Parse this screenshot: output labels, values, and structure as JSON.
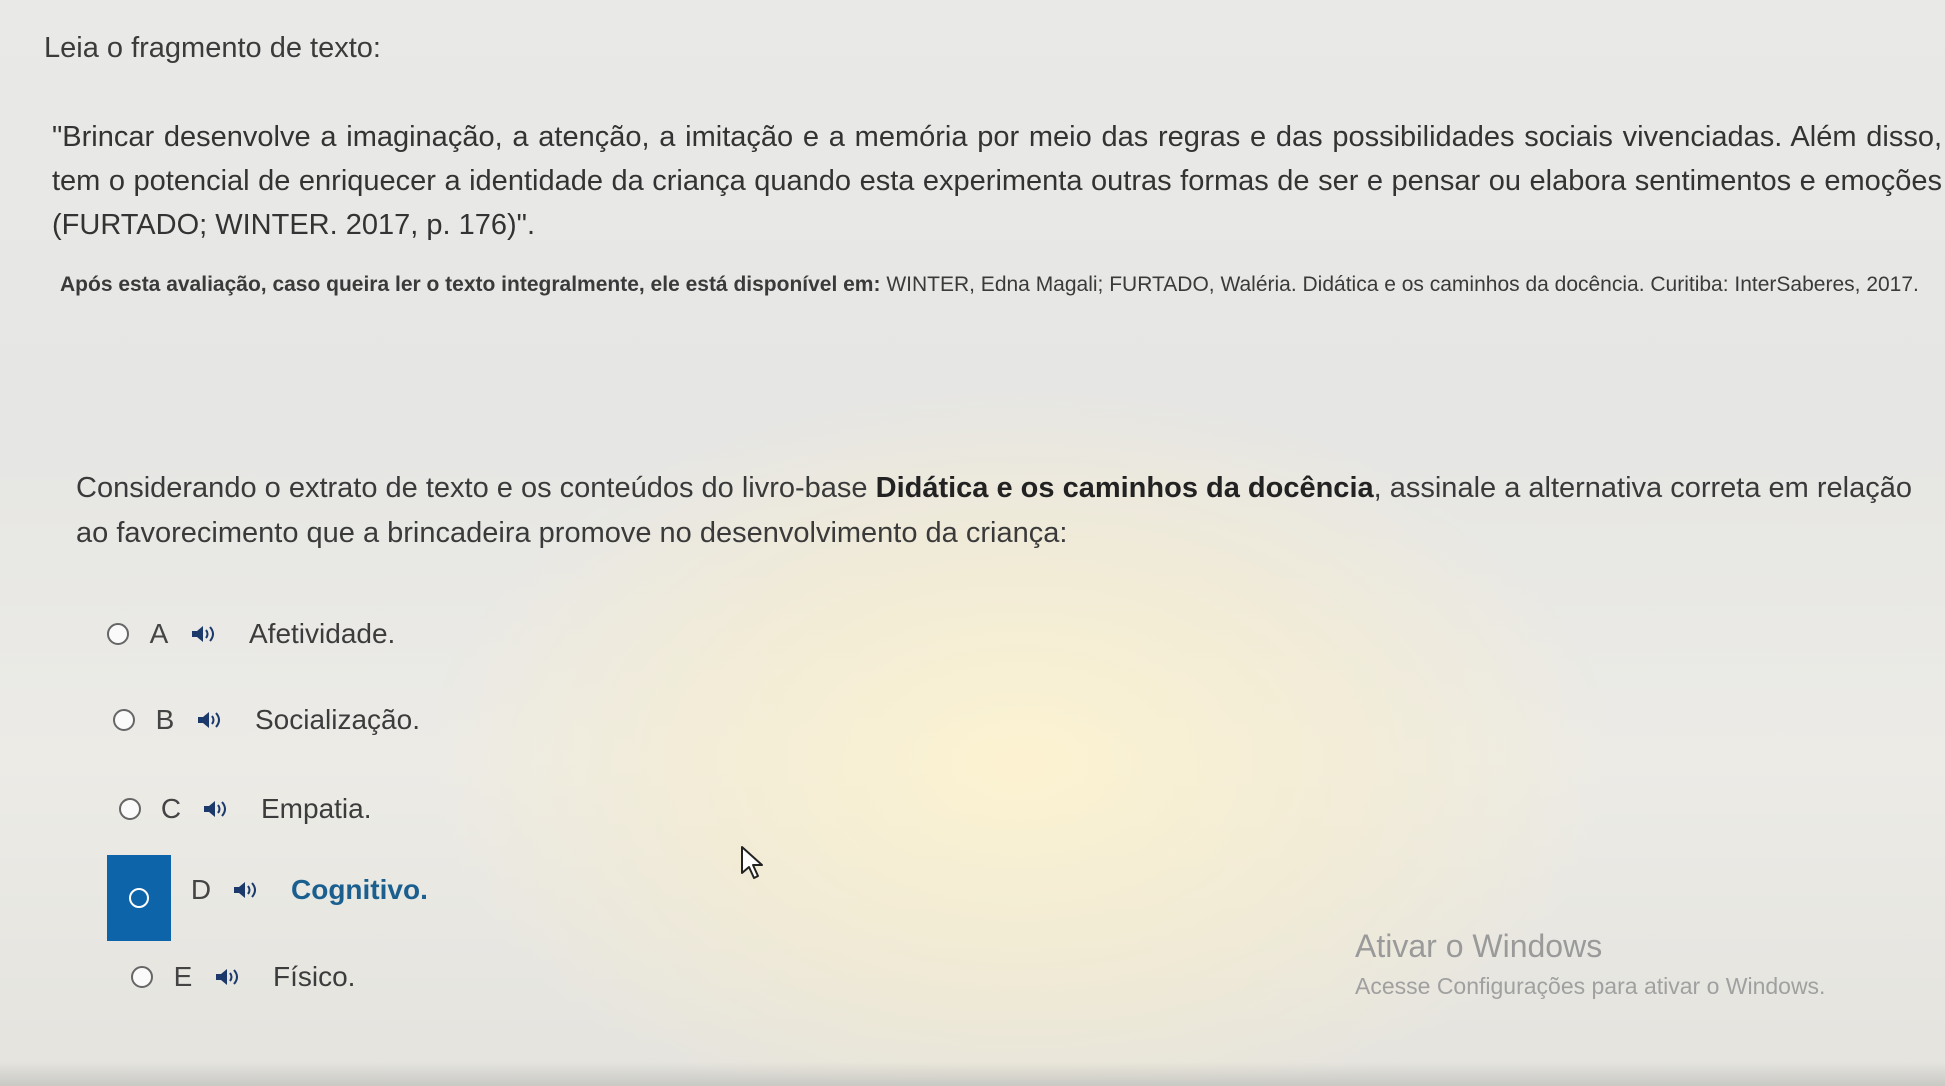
{
  "intro": "Leia o fragmento de texto:",
  "quote": "\"Brincar desenvolve a imaginação, a atenção, a imitação e a memória por meio das regras e das possibilidades sociais vivenciadas. Além disso, tem o potencial de enriquecer a identidade da criança quando esta experimenta outras formas de ser e pensar ou elabora sentimentos e emoções (FURTADO; WINTER. 2017, p. 176)\".",
  "note": {
    "prefix": "Após esta avaliação, caso queira ler o texto integralmente, ele está disponível em:",
    "reference": " WINTER, Edna Magali; FURTADO, Waléria. Didática e os caminhos da docência. Curitiba: InterSaberes, 2017."
  },
  "question": {
    "part1": "Considerando o extrato de texto e os conteúdos do livro-base ",
    "bold": "Didática e os caminhos da docência",
    "part2": ", assinale a alternativa correta em relação ao favorecimento que a brincadeira promove no desenvolvimento da criança:"
  },
  "options": [
    {
      "letter": "A",
      "text": "Afetividade."
    },
    {
      "letter": "B",
      "text": "Socialização."
    },
    {
      "letter": "C",
      "text": "Empatia."
    },
    {
      "letter": "D",
      "text": "Cognitivo."
    },
    {
      "letter": "E",
      "text": "Físico."
    }
  ],
  "selected_option": "D",
  "colors": {
    "selected_bg": "#0e64a8",
    "selected_text": "#1b5f8f"
  },
  "watermark": {
    "title": "Ativar o Windows",
    "subtitle": "Acesse Configurações para ativar o Windows."
  },
  "icons": {
    "audio": "speaker-icon",
    "radio": "radio-icon",
    "cursor": "mouse-pointer-icon"
  }
}
